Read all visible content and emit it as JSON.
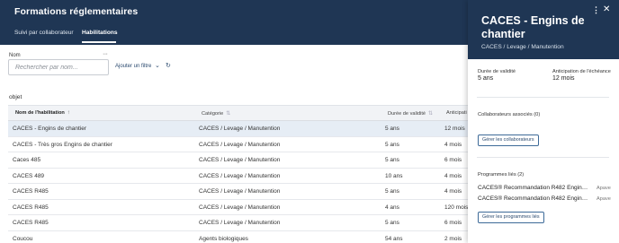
{
  "header": {
    "title": "Formations réglementaires",
    "tabs": [
      {
        "label": "Suivi par collaborateur"
      },
      {
        "label": "Habilitations"
      }
    ]
  },
  "filter": {
    "label": "Nom",
    "more": "···",
    "placeholder": "Rechercher par nom...",
    "add_filter": "Ajouter un filtre",
    "chevron": "⌄",
    "refresh": "↻"
  },
  "section_label": "objet",
  "table": {
    "columns": [
      "Nom de l'habilitation",
      "Catégorie",
      "Durée de validité",
      "Anticipati"
    ],
    "sort_icons": [
      "↑",
      "⇅",
      "⇅"
    ],
    "rows": [
      [
        "CACES - Engins de chantier",
        "CACES / Levage / Manutention",
        "5 ans",
        "12 mois"
      ],
      [
        "CACES - Très gros Engins de chantier",
        "CACES / Levage / Manutention",
        "5 ans",
        "4 mois"
      ],
      [
        "Caces 485",
        "CACES / Levage / Manutention",
        "5 ans",
        "6 mois"
      ],
      [
        "CACES 489",
        "CACES / Levage / Manutention",
        "10 ans",
        "4 mois"
      ],
      [
        "CACES R485",
        "CACES / Levage / Manutention",
        "5 ans",
        "4 mois"
      ],
      [
        "CACES R485",
        "CACES / Levage / Manutention",
        "4 ans",
        "120 mois"
      ],
      [
        "CACES R485",
        "CACES / Levage / Manutention",
        "5 ans",
        "6 mois"
      ],
      [
        "Coucou",
        "Agents biologiques",
        "54 ans",
        "2 mois"
      ]
    ]
  },
  "panel": {
    "title": "CACES - Engins de chantier",
    "subtitle": "CACES / Levage / Manutention",
    "more": "⋮",
    "close": "✕",
    "validity_label": "Durée de validité",
    "validity_value": "5 ans",
    "anticipation_label": "Anticipation de l'échéance",
    "anticipation_value": "12 mois",
    "collaborators_title": "Collaborateurs associés (0)",
    "manage_collaborators": "Gérer les collaborateurs",
    "programs_title": "Programmes liés (2)",
    "programs": [
      {
        "name": "CACES® Recommandation R482 Engins de chantier",
        "status": "Apave"
      },
      {
        "name": "CACES® Recommandation R482 Engins de chantier",
        "status": "Apave"
      }
    ],
    "manage_programs": "Gérer les programmes liés"
  },
  "colors": {
    "header_bg": "#1f3654",
    "selected_row": "#e6edf5",
    "accent": "#2b4a6f"
  }
}
